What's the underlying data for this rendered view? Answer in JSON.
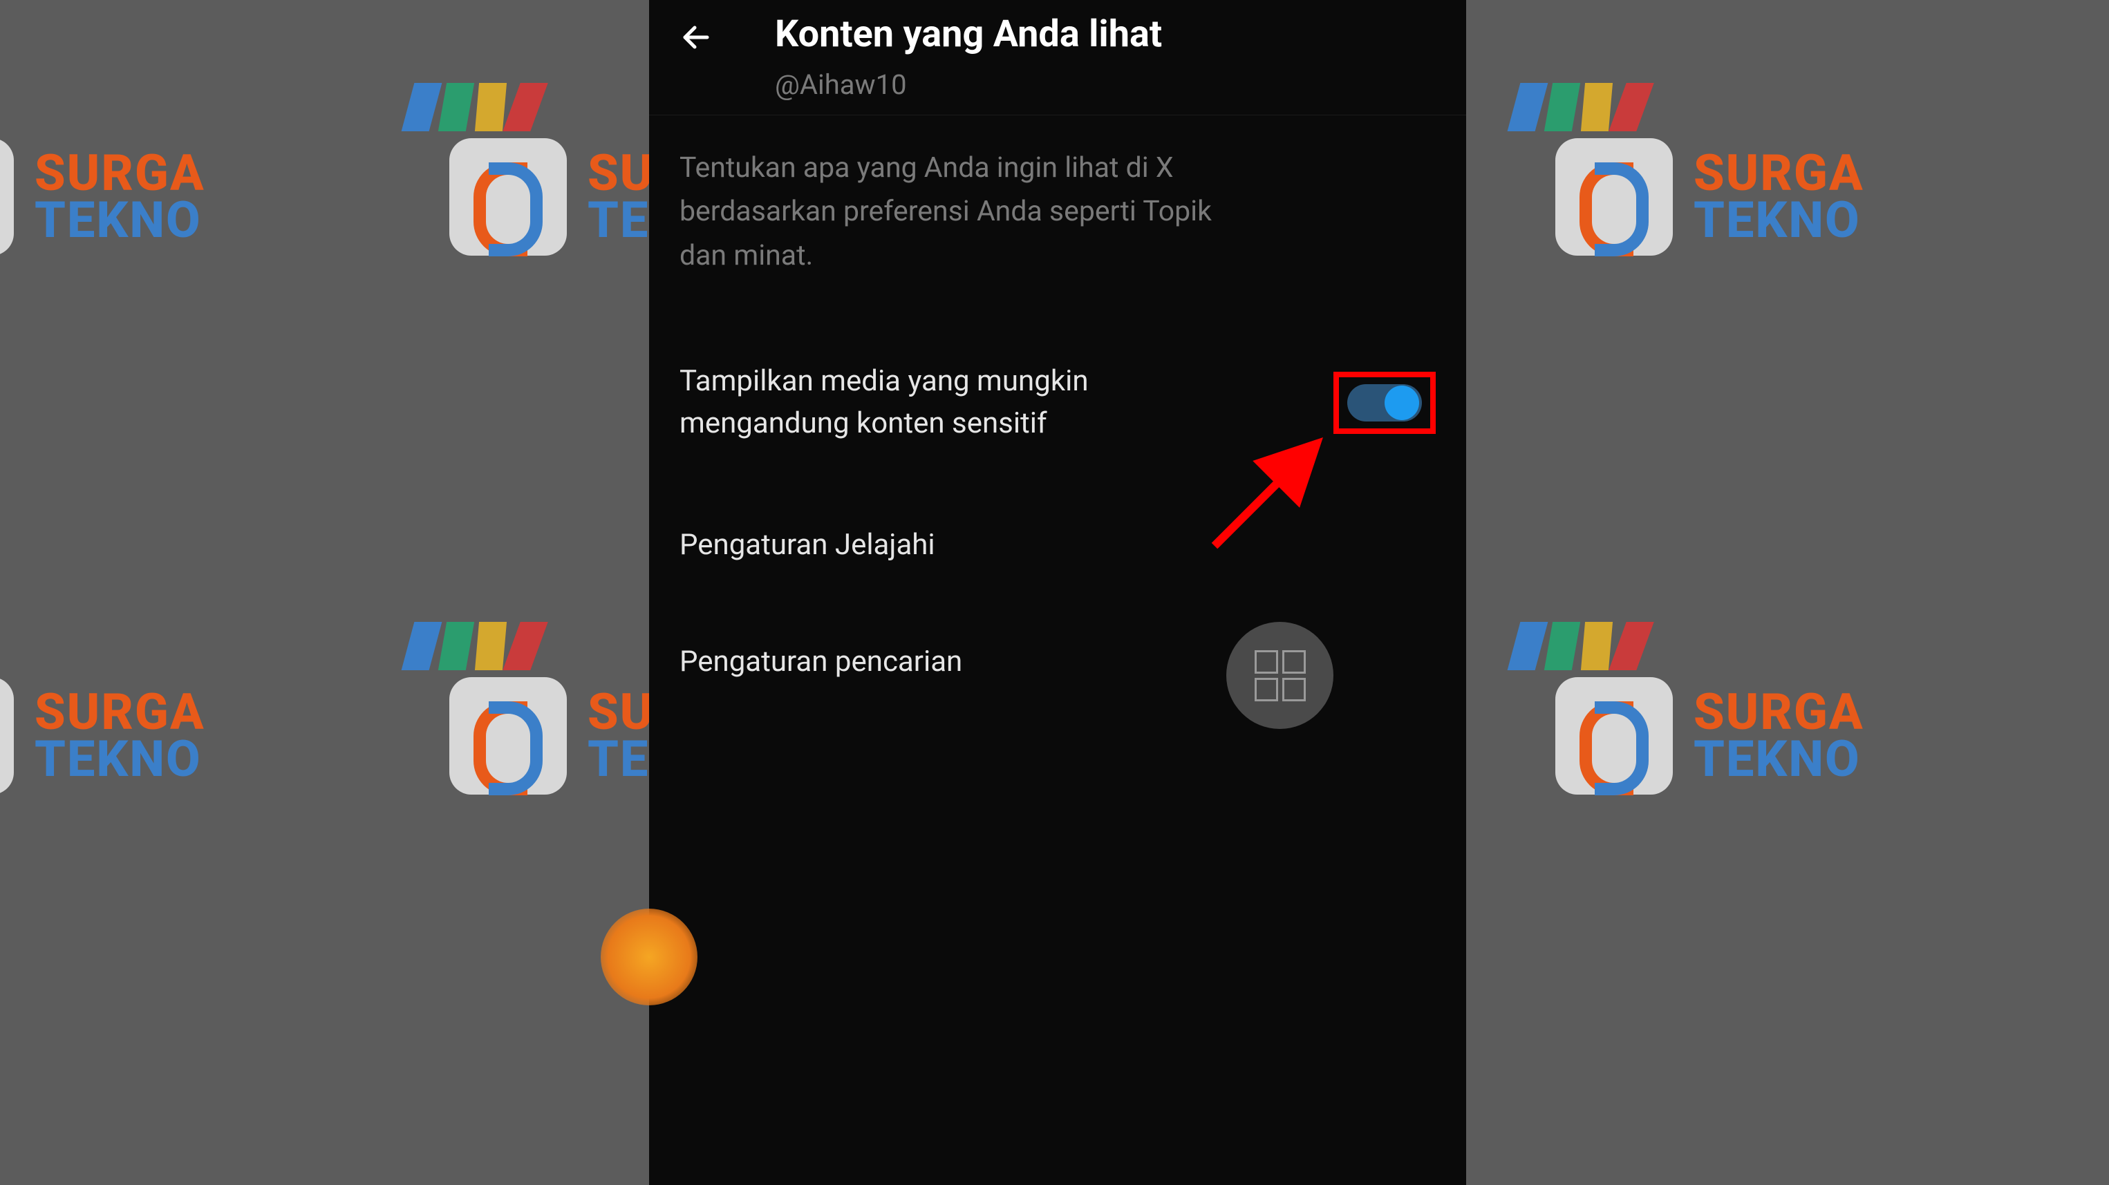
{
  "watermark": {
    "text_top": "SURGA",
    "text_bottom": "TEKNO"
  },
  "header": {
    "title": "Konten yang Anda lihat",
    "subtitle": "@Aihaw10"
  },
  "description": "Tentukan apa yang Anda ingin lihat di X berdasarkan preferensi Anda seperti Topik dan minat.",
  "settings": {
    "sensitive_media": {
      "label": "Tampilkan media yang mungkin mengandung konten sensitif",
      "enabled": true
    },
    "explore": {
      "label": "Pengaturan Jelajahi"
    },
    "search": {
      "label": "Pengaturan pencarian"
    }
  },
  "annotation": {
    "highlight_color": "#ff0000"
  }
}
